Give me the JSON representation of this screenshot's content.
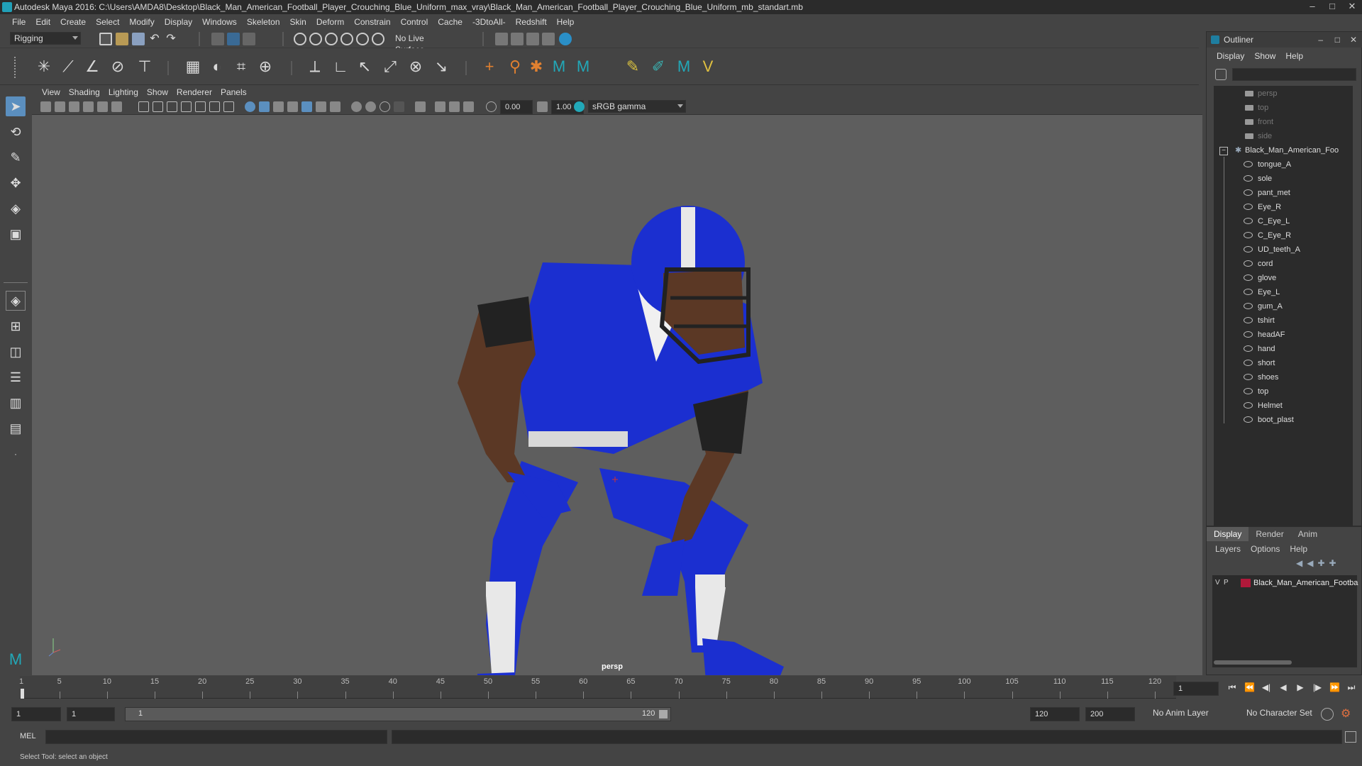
{
  "window": {
    "title": "Autodesk Maya 2016: C:\\Users\\AMDA8\\Desktop\\Black_Man_American_Football_Player_Crouching_Blue_Uniform_max_vray\\Black_Man_American_Football_Player_Crouching_Blue_Uniform_mb_standart.mb"
  },
  "menubar": [
    "File",
    "Edit",
    "Create",
    "Select",
    "Modify",
    "Display",
    "Windows",
    "Skeleton",
    "Skin",
    "Deform",
    "Constrain",
    "Control",
    "Cache",
    "-3DtoAll-",
    "Redshift",
    "Help"
  ],
  "statusline": {
    "mode": "Rigging",
    "live_surface": "No Live Surface"
  },
  "viewport": {
    "menu": [
      "View",
      "Shading",
      "Lighting",
      "Show",
      "Renderer",
      "Panels"
    ],
    "exposure": "0.00",
    "gamma": "1.00",
    "color_space": "sRGB gamma",
    "camera_label": "persp"
  },
  "outliner": {
    "title": "Outliner",
    "menu": [
      "Display",
      "Show",
      "Help"
    ],
    "cameras": [
      "persp",
      "top",
      "front",
      "side"
    ],
    "root": "Black_Man_American_Foo",
    "children": [
      "tongue_A",
      "sole",
      "pant_met",
      "Eye_R",
      "C_Eye_L",
      "C_Eye_R",
      "UD_teeth_A",
      "cord",
      "glove",
      "Eye_L",
      "gum_A",
      "tshirt",
      "headAF",
      "hand",
      "short",
      "shoes",
      "top",
      "Helmet",
      "boot_plast"
    ]
  },
  "channel_box": {
    "tabs": [
      "Display",
      "Render",
      "Anim"
    ],
    "menu": [
      "Layers",
      "Options",
      "Help"
    ],
    "layer": {
      "v": "V",
      "p": "P",
      "name": "Black_Man_American_Footba",
      "color": "#b0193a"
    }
  },
  "timeline": {
    "ticks": [
      1,
      5,
      10,
      15,
      20,
      25,
      30,
      35,
      40,
      45,
      50,
      55,
      60,
      65,
      70,
      75,
      80,
      85,
      90,
      95,
      100,
      105,
      110,
      115,
      120
    ],
    "current_frame": "1"
  },
  "range": {
    "start": "1",
    "anim_start": "1",
    "slider_start": "1",
    "slider_end": "120",
    "playback_end": "120",
    "anim_end": "200",
    "anim_layer": "No Anim Layer",
    "character_set": "No Character Set"
  },
  "command": {
    "label": "MEL"
  },
  "help_line": "Select Tool: select an object",
  "colors": {
    "uniform_blue": "#1b2fd0",
    "accent": "#21a0b8"
  }
}
